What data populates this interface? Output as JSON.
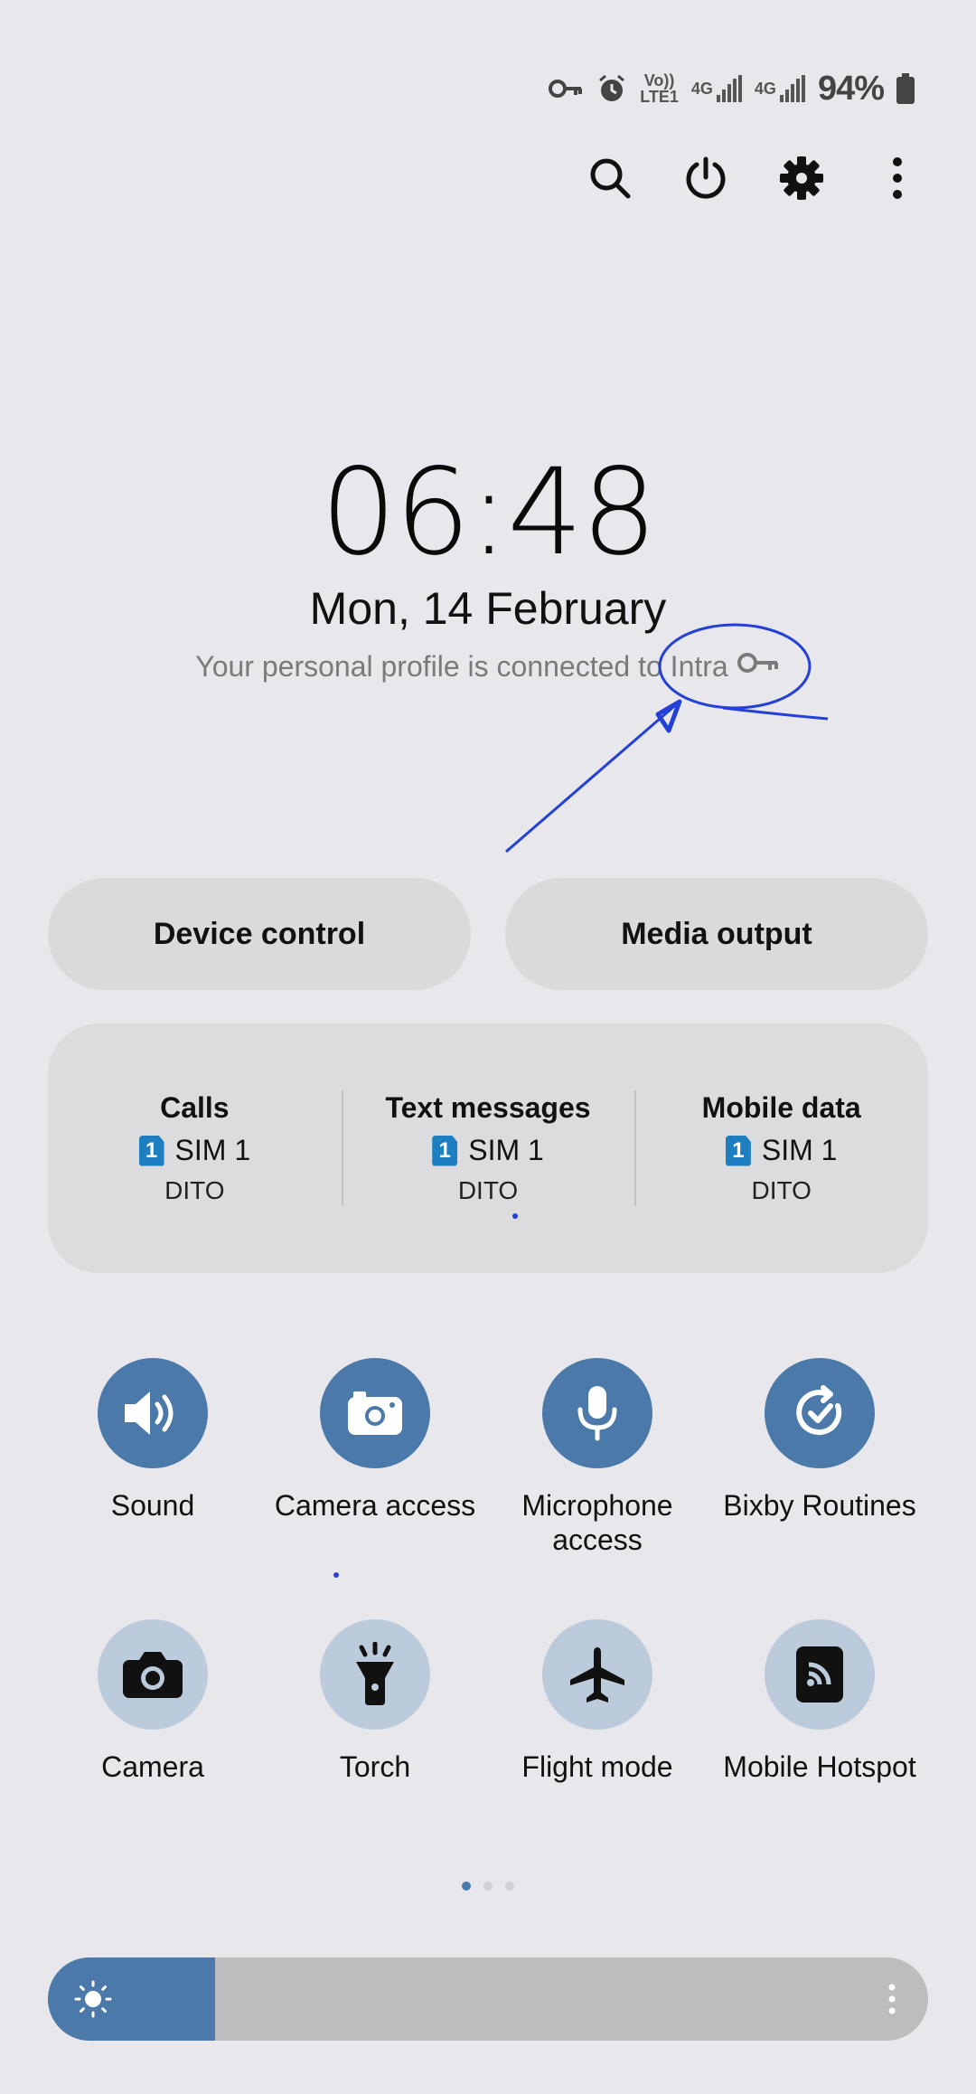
{
  "status_bar": {
    "icons": [
      "vpn-key-icon",
      "alarm-icon",
      "volte-icon",
      "signal-4g-icon",
      "signal-4g-icon"
    ],
    "volte_label_top": "Vo))",
    "volte_label_bottom": "LTE1",
    "network_label_1": "4G",
    "network_label_2": "4G",
    "battery_percent": "94%"
  },
  "top_actions": [
    "search-icon",
    "power-icon",
    "settings-gear-icon",
    "more-vert-icon"
  ],
  "clock": {
    "time": "06:48",
    "date": "Mon, 14 February",
    "profile_text": "Your personal profile is connected to Intra"
  },
  "buttons": {
    "device_control": "Device control",
    "media_output": "Media output"
  },
  "sim_panel": [
    {
      "title": "Calls",
      "sim_number": "1",
      "sim": "SIM 1",
      "carrier": "DITO"
    },
    {
      "title": "Text messages",
      "sim_number": "1",
      "sim": "SIM 1",
      "carrier": "DITO"
    },
    {
      "title": "Mobile data",
      "sim_number": "1",
      "sim": "SIM 1",
      "carrier": "DITO"
    }
  ],
  "tiles_row1": [
    {
      "label": "Sound",
      "icon": "sound-icon",
      "state": "on"
    },
    {
      "label": "Camera access",
      "icon": "camera-access-icon",
      "state": "on"
    },
    {
      "label": "Microphone access",
      "icon": "microphone-icon",
      "state": "on"
    },
    {
      "label": "Bixby Routines",
      "icon": "bixby-routines-icon",
      "state": "on"
    }
  ],
  "tiles_row2": [
    {
      "label": "Camera",
      "icon": "camera-icon",
      "state": "off"
    },
    {
      "label": "Torch",
      "icon": "torch-icon",
      "state": "off"
    },
    {
      "label": "Flight mode",
      "icon": "airplane-icon",
      "state": "off"
    },
    {
      "label": "Mobile Hotspot",
      "icon": "hotspot-icon",
      "state": "off"
    }
  ],
  "page_indicator": {
    "pages": 3,
    "current": 1
  },
  "brightness": {
    "level": 0.19
  },
  "colors": {
    "accent": "#4b79a9",
    "tile_off": "#bccbdb",
    "background": "#e8e8ec",
    "annotation": "#2440d6"
  }
}
